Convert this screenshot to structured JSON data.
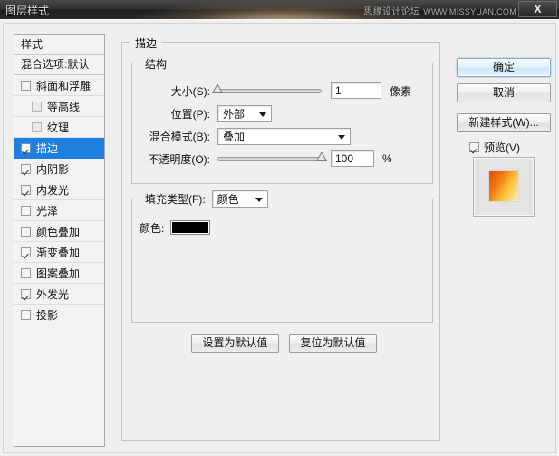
{
  "window": {
    "title": "图层样式",
    "close_label": "X",
    "watermark_cn": "思缘设计论坛",
    "watermark_url": "WWW.MISSYUAN.COM"
  },
  "styles_list": {
    "header": "样式",
    "blending_options": "混合选项:默认",
    "items": [
      {
        "label": "斜面和浮雕",
        "checked": false,
        "indent": false,
        "selected": false
      },
      {
        "label": "等高线",
        "checked": false,
        "indent": true,
        "selected": false
      },
      {
        "label": "纹理",
        "checked": false,
        "indent": true,
        "selected": false
      },
      {
        "label": "描边",
        "checked": true,
        "indent": false,
        "selected": true
      },
      {
        "label": "内阴影",
        "checked": true,
        "indent": false,
        "selected": false
      },
      {
        "label": "内发光",
        "checked": true,
        "indent": false,
        "selected": false
      },
      {
        "label": "光泽",
        "checked": false,
        "indent": false,
        "selected": false
      },
      {
        "label": "颜色叠加",
        "checked": false,
        "indent": false,
        "selected": false
      },
      {
        "label": "渐变叠加",
        "checked": true,
        "indent": false,
        "selected": false
      },
      {
        "label": "图案叠加",
        "checked": false,
        "indent": false,
        "selected": false
      },
      {
        "label": "外发光",
        "checked": true,
        "indent": false,
        "selected": false
      },
      {
        "label": "投影",
        "checked": false,
        "indent": false,
        "selected": false
      }
    ]
  },
  "stroke_panel": {
    "title": "描边",
    "structure": {
      "title": "结构",
      "size": {
        "label": "大小(S):",
        "value": "1",
        "unit": "像素",
        "slider_percent": 0
      },
      "position": {
        "label": "位置(P):",
        "value": "外部"
      },
      "blend_mode": {
        "label": "混合模式(B):",
        "value": "叠加"
      },
      "opacity": {
        "label": "不透明度(O):",
        "value": "100",
        "unit": "%",
        "slider_percent": 100
      }
    },
    "fill_type": {
      "title": "填充类型(F):",
      "value": "颜色",
      "color_label": "颜色:",
      "color_hex": "#000000"
    },
    "set_default_label": "设置为默认值",
    "reset_default_label": "复位为默认值"
  },
  "right_panel": {
    "ok_label": "确定",
    "cancel_label": "取消",
    "new_style_label": "新建样式(W)...",
    "preview_label": "预览(V)",
    "preview_checked": true
  }
}
